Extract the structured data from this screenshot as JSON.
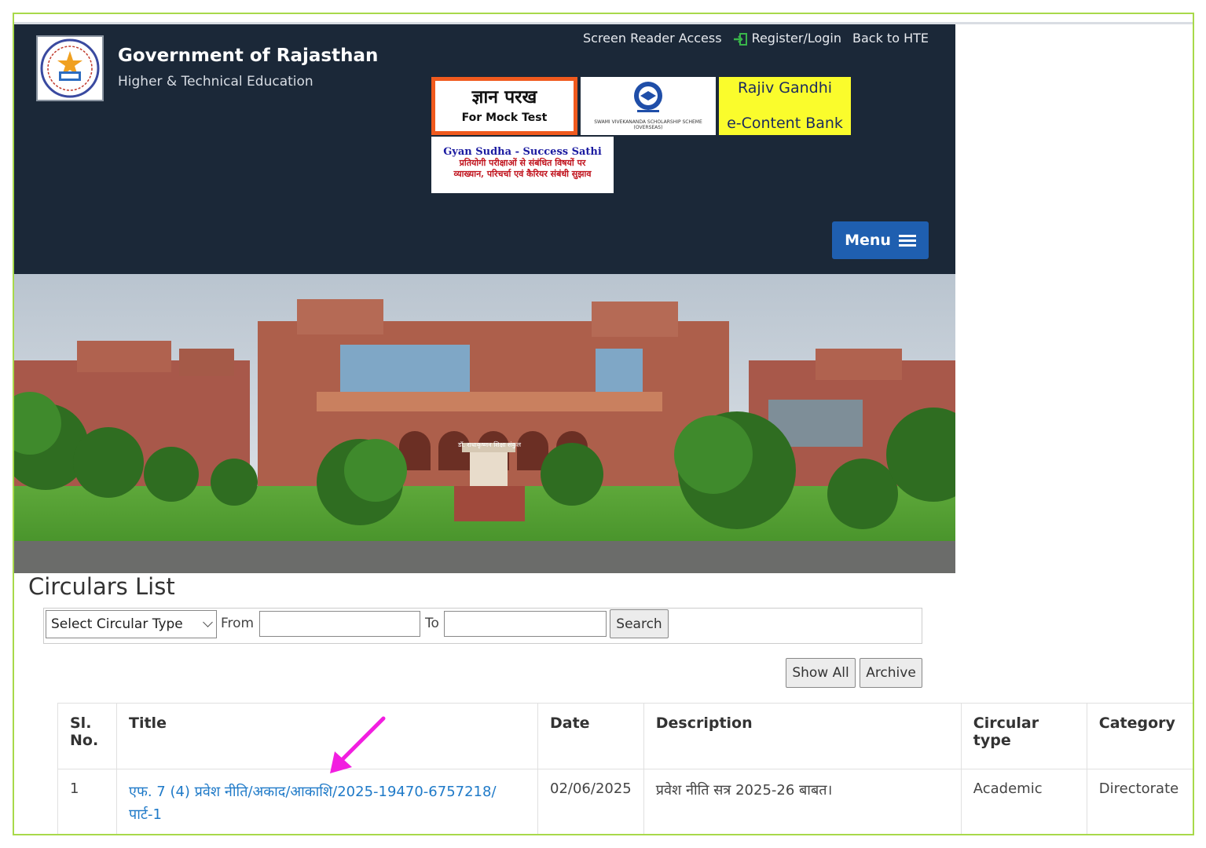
{
  "header": {
    "title": "Government of Rajasthan",
    "subtitle": "Higher & Technical Education",
    "links": {
      "screen_reader": "Screen Reader Access",
      "login": "Register/Login",
      "back": "Back to HTE"
    },
    "menu_label": "Menu"
  },
  "banners": {
    "gyan_parakh": {
      "title": "ज्ञान परख",
      "subtitle": "For Mock Test"
    },
    "svs": {
      "caption": "SWAMI VIVEKANANDA SCHOLARSHIP SCHEME (OVERSEAS)"
    },
    "rajiv_gandhi": {
      "line1": "Rajiv Gandhi",
      "line2": "e-Content Bank"
    },
    "gyan_sudha": {
      "title": "Gyan Sudha - Success Sathi",
      "line1": "प्रतियोगी परीक्षाओं से संबंधित विषयों पर",
      "line2": "व्याख्यान, परिचर्चा एवं कैरियर संबंधी सुझाव"
    }
  },
  "photo": {
    "signage": "डॉ. राधाकृष्णन शिक्षा संकुल"
  },
  "circulars": {
    "heading": "Circulars List",
    "select_placeholder": "Select Circular Type",
    "from_label": "From",
    "to_label": "To",
    "search_label": "Search",
    "show_all_label": "Show All",
    "archive_label": "Archive",
    "columns": [
      "Sl. No.",
      "Title",
      "Date",
      "Description",
      "Circular type",
      "Category"
    ],
    "rows": [
      {
        "sl": "1",
        "title": "एफ. 7 (4) प्रवेश नीति/अकाद/आकाशि/2025-19470-6757218/ पार्ट-1",
        "date": "02/06/2025",
        "description": "प्रवेश नीति सत्र 2025-26 बाबत।",
        "type": "Academic",
        "category": "Directorate"
      }
    ]
  },
  "colors": {
    "header_bg": "#1b2838",
    "accent_blue": "#1f5fb0",
    "link": "#1f7ac8",
    "frame": "#a8d94a",
    "annotation_arrow": "#f21ee0"
  }
}
